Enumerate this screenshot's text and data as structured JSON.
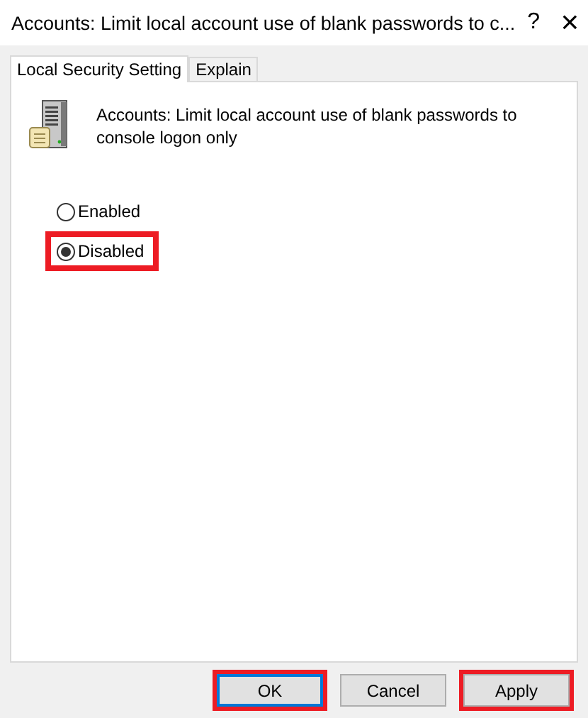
{
  "window": {
    "title": "Accounts: Limit local account use of blank passwords to c...",
    "help": "?",
    "close": "×"
  },
  "tabs": [
    {
      "label": "Local Security Setting",
      "selected": true
    },
    {
      "label": "Explain",
      "selected": false
    }
  ],
  "policy": {
    "description": "Accounts: Limit local account use of blank passwords to console logon only"
  },
  "options": [
    {
      "label": "Enabled",
      "selected": false,
      "highlighted": false
    },
    {
      "label": "Disabled",
      "selected": true,
      "highlighted": true
    }
  ],
  "buttons": [
    {
      "label": "OK",
      "default": true,
      "highlighted": true
    },
    {
      "label": "Cancel",
      "default": false,
      "highlighted": false
    },
    {
      "label": "Apply",
      "default": false,
      "highlighted": true
    }
  ]
}
